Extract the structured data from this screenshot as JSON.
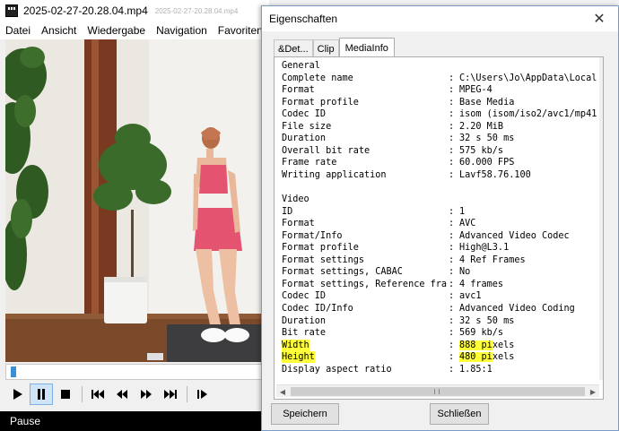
{
  "player": {
    "title": "2025-02-27-20.28.04.mp4",
    "title_ghost": "2025-02-27-20.28.04.mp4",
    "menu": [
      "Datei",
      "Ansicht",
      "Wiedergabe",
      "Navigation",
      "Favoriten"
    ],
    "controls": [
      "play-icon",
      "pause-icon",
      "stop-icon",
      "skip-back-icon",
      "rewind-icon",
      "fast-forward-icon",
      "skip-forward-icon",
      "frame-step-icon"
    ],
    "seek_position": 0.01,
    "status": "Pause"
  },
  "dialog": {
    "title": "Eigenschaften",
    "close_symbol": "✕",
    "tabs": [
      "&Det...",
      "Clip",
      "MediaInfo"
    ],
    "active_tab": "MediaInfo",
    "buttons": {
      "save": "Speichern",
      "close": "Schließen"
    },
    "highlight_color": "#ffff3a",
    "mediainfo": [
      {
        "key": "General",
        "value": ""
      },
      {
        "key": "Complete name",
        "value": "C:\\Users\\Jo\\AppData\\Local"
      },
      {
        "key": "Format",
        "value": "MPEG-4"
      },
      {
        "key": "Format profile",
        "value": "Base Media"
      },
      {
        "key": "Codec ID",
        "value": "isom (isom/iso2/avc1/mp41"
      },
      {
        "key": "File size",
        "value": "2.20 MiB"
      },
      {
        "key": "Duration",
        "value": "32 s 50 ms"
      },
      {
        "key": "Overall bit rate",
        "value": "575 kb/s"
      },
      {
        "key": "Frame rate",
        "value": "60.000 FPS"
      },
      {
        "key": "Writing application",
        "value": "Lavf58.76.100"
      },
      {
        "key": "",
        "value": ""
      },
      {
        "key": "Video",
        "value": ""
      },
      {
        "key": "ID",
        "value": "1"
      },
      {
        "key": "Format",
        "value": "AVC"
      },
      {
        "key": "Format/Info",
        "value": "Advanced Video Codec"
      },
      {
        "key": "Format profile",
        "value": "High@L3.1"
      },
      {
        "key": "Format settings",
        "value": "4 Ref Frames"
      },
      {
        "key": "Format settings, CABAC",
        "value": "No"
      },
      {
        "key": "Format settings, Reference fra",
        "value": "4 frames"
      },
      {
        "key": "Codec ID",
        "value": "avc1"
      },
      {
        "key": "Codec ID/Info",
        "value": "Advanced Video Coding"
      },
      {
        "key": "Duration",
        "value": "32 s 50 ms"
      },
      {
        "key": "Bit rate",
        "value": "569 kb/s"
      },
      {
        "key": "Width",
        "value": "888 pixels",
        "highlight_key": true,
        "highlight_value": "888 pi"
      },
      {
        "key": "Height",
        "value": "480 pixels",
        "highlight_key": true,
        "highlight_value": "480 pi"
      },
      {
        "key": "Display aspect ratio",
        "value": "1.85:1"
      }
    ]
  }
}
